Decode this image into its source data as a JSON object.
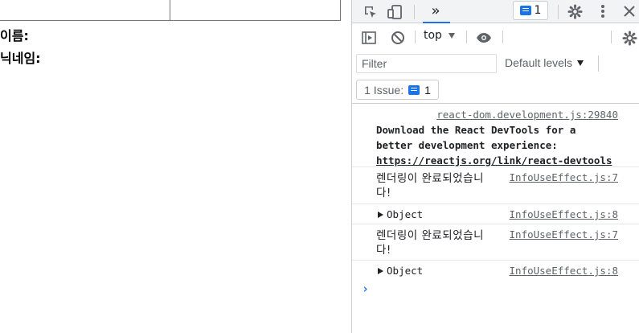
{
  "page": {
    "inputs": [
      {
        "value": "",
        "placeholder": ""
      },
      {
        "value": "",
        "placeholder": ""
      }
    ],
    "labels": {
      "name": "이름:",
      "nickname": "닉네임:"
    }
  },
  "devtools": {
    "toolbar": {
      "icons": [
        "inspect-icon",
        "device-toggle-icon",
        "more-tabs-icon",
        "gear-icon",
        "kebab-menu-icon",
        "close-icon"
      ],
      "more_tabs_label": "»",
      "issues_count": "1"
    },
    "console_toolbar": {
      "context": "top",
      "filter_placeholder": "Filter",
      "levels": "Default levels",
      "issues_label": "1 Issue:",
      "issues_count": "1"
    },
    "messages": [
      {
        "source": "react-dom.development.js:29840",
        "text": "Download the React DevTools for a better development experience: ",
        "link": "https://reactjs.org/link/react-devtools"
      },
      {
        "source": "InfoUseEffect.js:7",
        "text": "렌더링이 완료되었습니다!"
      },
      {
        "source": "InfoUseEffect.js:8",
        "text": "Object"
      },
      {
        "source": "InfoUseEffect.js:7",
        "text": "렌더링이 완료되었습니다!"
      },
      {
        "source": "InfoUseEffect.js:8",
        "text": "Object"
      }
    ],
    "prompt_symbol": "›"
  },
  "colors": {
    "accent": "#1a73e8",
    "toolbar_bg": "#f1f3f4",
    "border": "#cbcdd1",
    "icon": "#5f6368"
  }
}
